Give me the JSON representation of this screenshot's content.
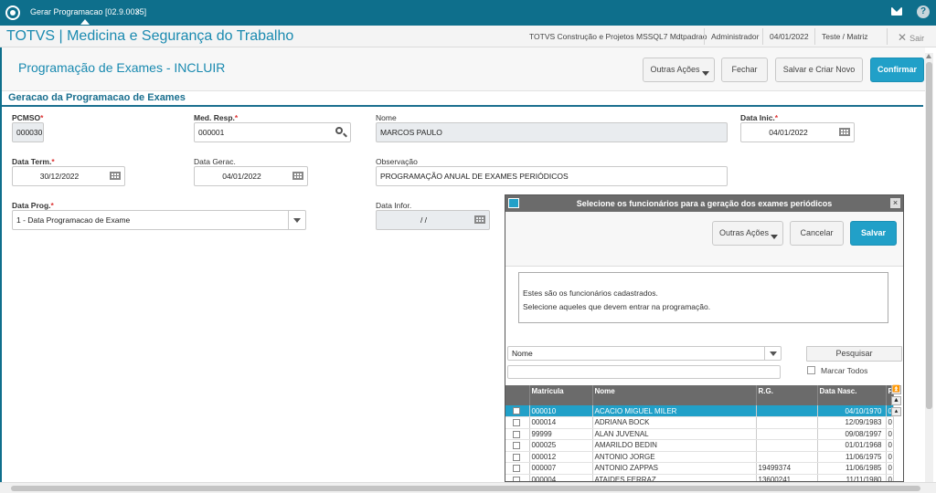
{
  "topbar": {
    "tab_label": "Gerar Programacao [02.9.0035]",
    "tab_close": "×",
    "mail_icon": "mail-icon",
    "help_icon": "help-icon",
    "help_glyph": "?"
  },
  "appbar": {
    "title": "TOTVS | Medicina e Segurança do Trabalho",
    "company": "TOTVS Construção e Projetos MSSQL7 Mdtpadrao",
    "user": "Administrador",
    "date": "04/01/2022",
    "env": "Teste / Matriz",
    "exit_label": "Sair"
  },
  "page": {
    "title": "Programação de Exames - INCLUIR",
    "buttons": {
      "outras_acoes": "Outras Ações",
      "fechar": "Fechar",
      "salvar_criar": "Salvar e Criar Novo",
      "confirmar": "Confirmar"
    },
    "section_title": "Geracao da Programacao de Exames"
  },
  "form": {
    "pcmso": {
      "label": "PCMSO",
      "value": "000030"
    },
    "med_resp": {
      "label": "Med. Resp.",
      "value": "000001"
    },
    "nome": {
      "label": "Nome",
      "value": "MARCOS PAULO"
    },
    "data_inic": {
      "label": "Data Inic.",
      "value": "04/01/2022"
    },
    "data_term": {
      "label": "Data Term.",
      "value": "30/12/2022"
    },
    "data_gerac": {
      "label": "Data Gerac.",
      "value": "04/01/2022"
    },
    "observacao": {
      "label": "Observação",
      "value": "PROGRAMAÇÃO ANUAL DE EXAMES PERIÓDICOS"
    },
    "data_prog": {
      "label": "Data Prog.",
      "value": "1 - Data Programacao de Exame"
    },
    "data_infor": {
      "label": "Data Infor.",
      "value": "/ /"
    },
    "required_mark": "*"
  },
  "dialog": {
    "title": "Selecione os funcionários para a geração dos exames periódicos",
    "close": "×",
    "buttons": {
      "outras_acoes": "Outras Ações",
      "cancelar": "Cancelar",
      "salvar": "Salvar"
    },
    "message_line1": "Estes são os funcionários cadastrados.",
    "message_line2": "Selecione aqueles que devem entrar na programação.",
    "search_field": "Nome",
    "search_value": "",
    "pesquisar": "Pesquisar",
    "marcar_todos": "Marcar Todos",
    "columns": {
      "matricula": "Matrícula",
      "nome": "Nome",
      "rg": "R.G.",
      "data_nasc": "Data Nasc.",
      "extra": "F"
    },
    "rows": [
      {
        "matricula": "000010",
        "nome": "ACACIO MIGUEL MILER",
        "rg": "",
        "data_nasc": "04/10/1970",
        "extra": "0",
        "selected": true
      },
      {
        "matricula": "000014",
        "nome": "ADRIANA BOCK",
        "rg": "",
        "data_nasc": "12/09/1983",
        "extra": "0",
        "selected": false
      },
      {
        "matricula": "99999",
        "nome": "ALAN JUVENAL",
        "rg": "",
        "data_nasc": "09/08/1997",
        "extra": "0",
        "selected": false
      },
      {
        "matricula": "000025",
        "nome": "AMARILDO BEDIN",
        "rg": "",
        "data_nasc": "01/01/1968",
        "extra": "0",
        "selected": false
      },
      {
        "matricula": "000012",
        "nome": "ANTONIO JORGE",
        "rg": "",
        "data_nasc": "11/06/1975",
        "extra": "0",
        "selected": false
      },
      {
        "matricula": "000007",
        "nome": "ANTONIO ZAPPAS",
        "rg": "19499374",
        "data_nasc": "11/06/1985",
        "extra": "0",
        "selected": false
      },
      {
        "matricula": "000004",
        "nome": "ATAIDES FERRAZ",
        "rg": "13600241",
        "data_nasc": "11/11/1980",
        "extra": "0",
        "selected": false
      }
    ]
  }
}
